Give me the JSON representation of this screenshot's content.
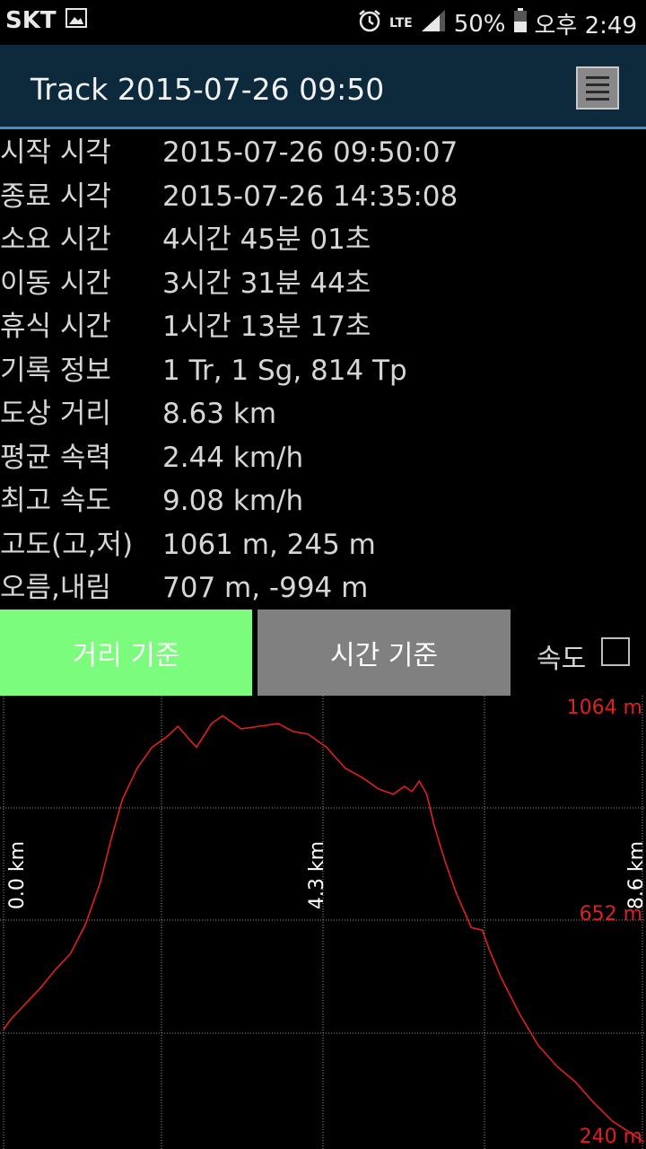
{
  "status_bar": {
    "carrier": "SKT",
    "network": "LTE",
    "battery": "50%",
    "time": "오후 2:49"
  },
  "app_bar": {
    "title": "Track 2015-07-26 09:50",
    "menu_icon": "menu-icon"
  },
  "info_rows": [
    {
      "label": "시작 시각",
      "value": "2015-07-26 09:50:07"
    },
    {
      "label": "종료 시각",
      "value": "2015-07-26 14:35:08"
    },
    {
      "label": "소요 시간",
      "value": "4시간 45분 01초"
    },
    {
      "label": "이동 시간",
      "value": "3시간 31분 44초"
    },
    {
      "label": "휴식 시간",
      "value": "1시간 13분 17초"
    },
    {
      "label": "기록 정보",
      "value": "1 Tr, 1 Sg, 814 Tp"
    },
    {
      "label": "도상 거리",
      "value": "8.63 km"
    },
    {
      "label": "평균 속력",
      "value": "2.44 km/h"
    },
    {
      "label": "최고 속도",
      "value": "9.08 km/h"
    },
    {
      "label": "고도(고,저)",
      "value": "1061 m, 245 m"
    },
    {
      "label": "오름,내림",
      "value": "707 m, -994 m"
    }
  ],
  "toggle": {
    "distance_label": "거리 기준",
    "time_label": "시간 기준",
    "speed_label": "속도",
    "speed_checked": false,
    "active": "distance",
    "active_color": "#7cfc7c",
    "inactive_color": "#808080"
  },
  "chart_data": {
    "type": "line",
    "x_ticks": [
      "0.0 km",
      "4.3 km",
      "8.6 km"
    ],
    "x_tick_values": [
      0,
      4.3,
      8.6
    ],
    "y_ticks": [
      "1064 m",
      "652 m",
      "240 m"
    ],
    "y_tick_values": [
      1064,
      652,
      240
    ],
    "xlim": [
      0,
      8.63
    ],
    "ylim": [
      240,
      1064
    ],
    "grid": true,
    "line_color": "#e02020",
    "label_color": "#e02020",
    "series": [
      {
        "x": [
          0,
          0.1,
          0.3,
          0.5,
          0.7,
          0.9,
          1.1,
          1.3,
          1.45,
          1.6,
          1.8,
          2.0,
          2.2,
          2.35,
          2.5,
          2.6,
          2.8,
          2.95,
          3.2,
          3.45,
          3.7,
          3.9,
          4.1,
          4.35,
          4.6,
          4.85,
          5.05,
          5.25,
          5.4,
          5.5,
          5.6,
          5.7,
          5.8,
          5.95,
          6.1,
          6.3,
          6.45,
          6.55,
          6.7,
          6.95,
          7.2,
          7.45,
          7.7,
          7.95,
          8.2,
          8.63
        ],
        "y": [
          460,
          480,
          510,
          540,
          575,
          605,
          660,
          740,
          825,
          900,
          960,
          1000,
          1020,
          1040,
          1015,
          1000,
          1045,
          1060,
          1035,
          1040,
          1045,
          1030,
          1025,
          1000,
          960,
          940,
          920,
          910,
          925,
          915,
          935,
          910,
          850,
          780,
          720,
          655,
          650,
          610,
          560,
          490,
          430,
          390,
          360,
          320,
          285,
          245
        ]
      }
    ]
  }
}
